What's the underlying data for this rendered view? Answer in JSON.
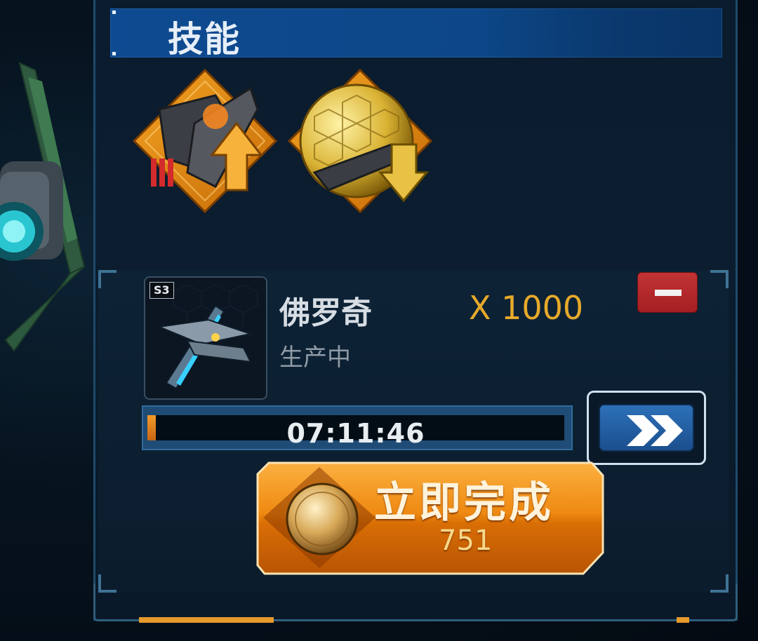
{
  "skills_section": {
    "title": "技能",
    "skills": [
      {
        "icon": "fleet-attack-up-icon",
        "trend": "up"
      },
      {
        "icon": "shield-defense-down-icon",
        "trend": "down"
      }
    ]
  },
  "production_queue": {
    "unit": {
      "tier": "S3",
      "name": "佛罗奇",
      "status": "生产中",
      "quantity": "X 1000",
      "icon": "frigate-ship-icon"
    },
    "timer": "07:11:46",
    "progress_fraction": 0.02,
    "remove_icon": "minus-icon",
    "speedup_icon": "double-chevron-right-icon",
    "complete_button": {
      "label": "立即完成",
      "cost": "751",
      "icon": "gold-coin-icon"
    }
  },
  "colors": {
    "accent_blue": "#0e4a91",
    "accent_orange": "#e8890f",
    "gold_text": "#e7a92a",
    "danger_red": "#b52a2c"
  }
}
